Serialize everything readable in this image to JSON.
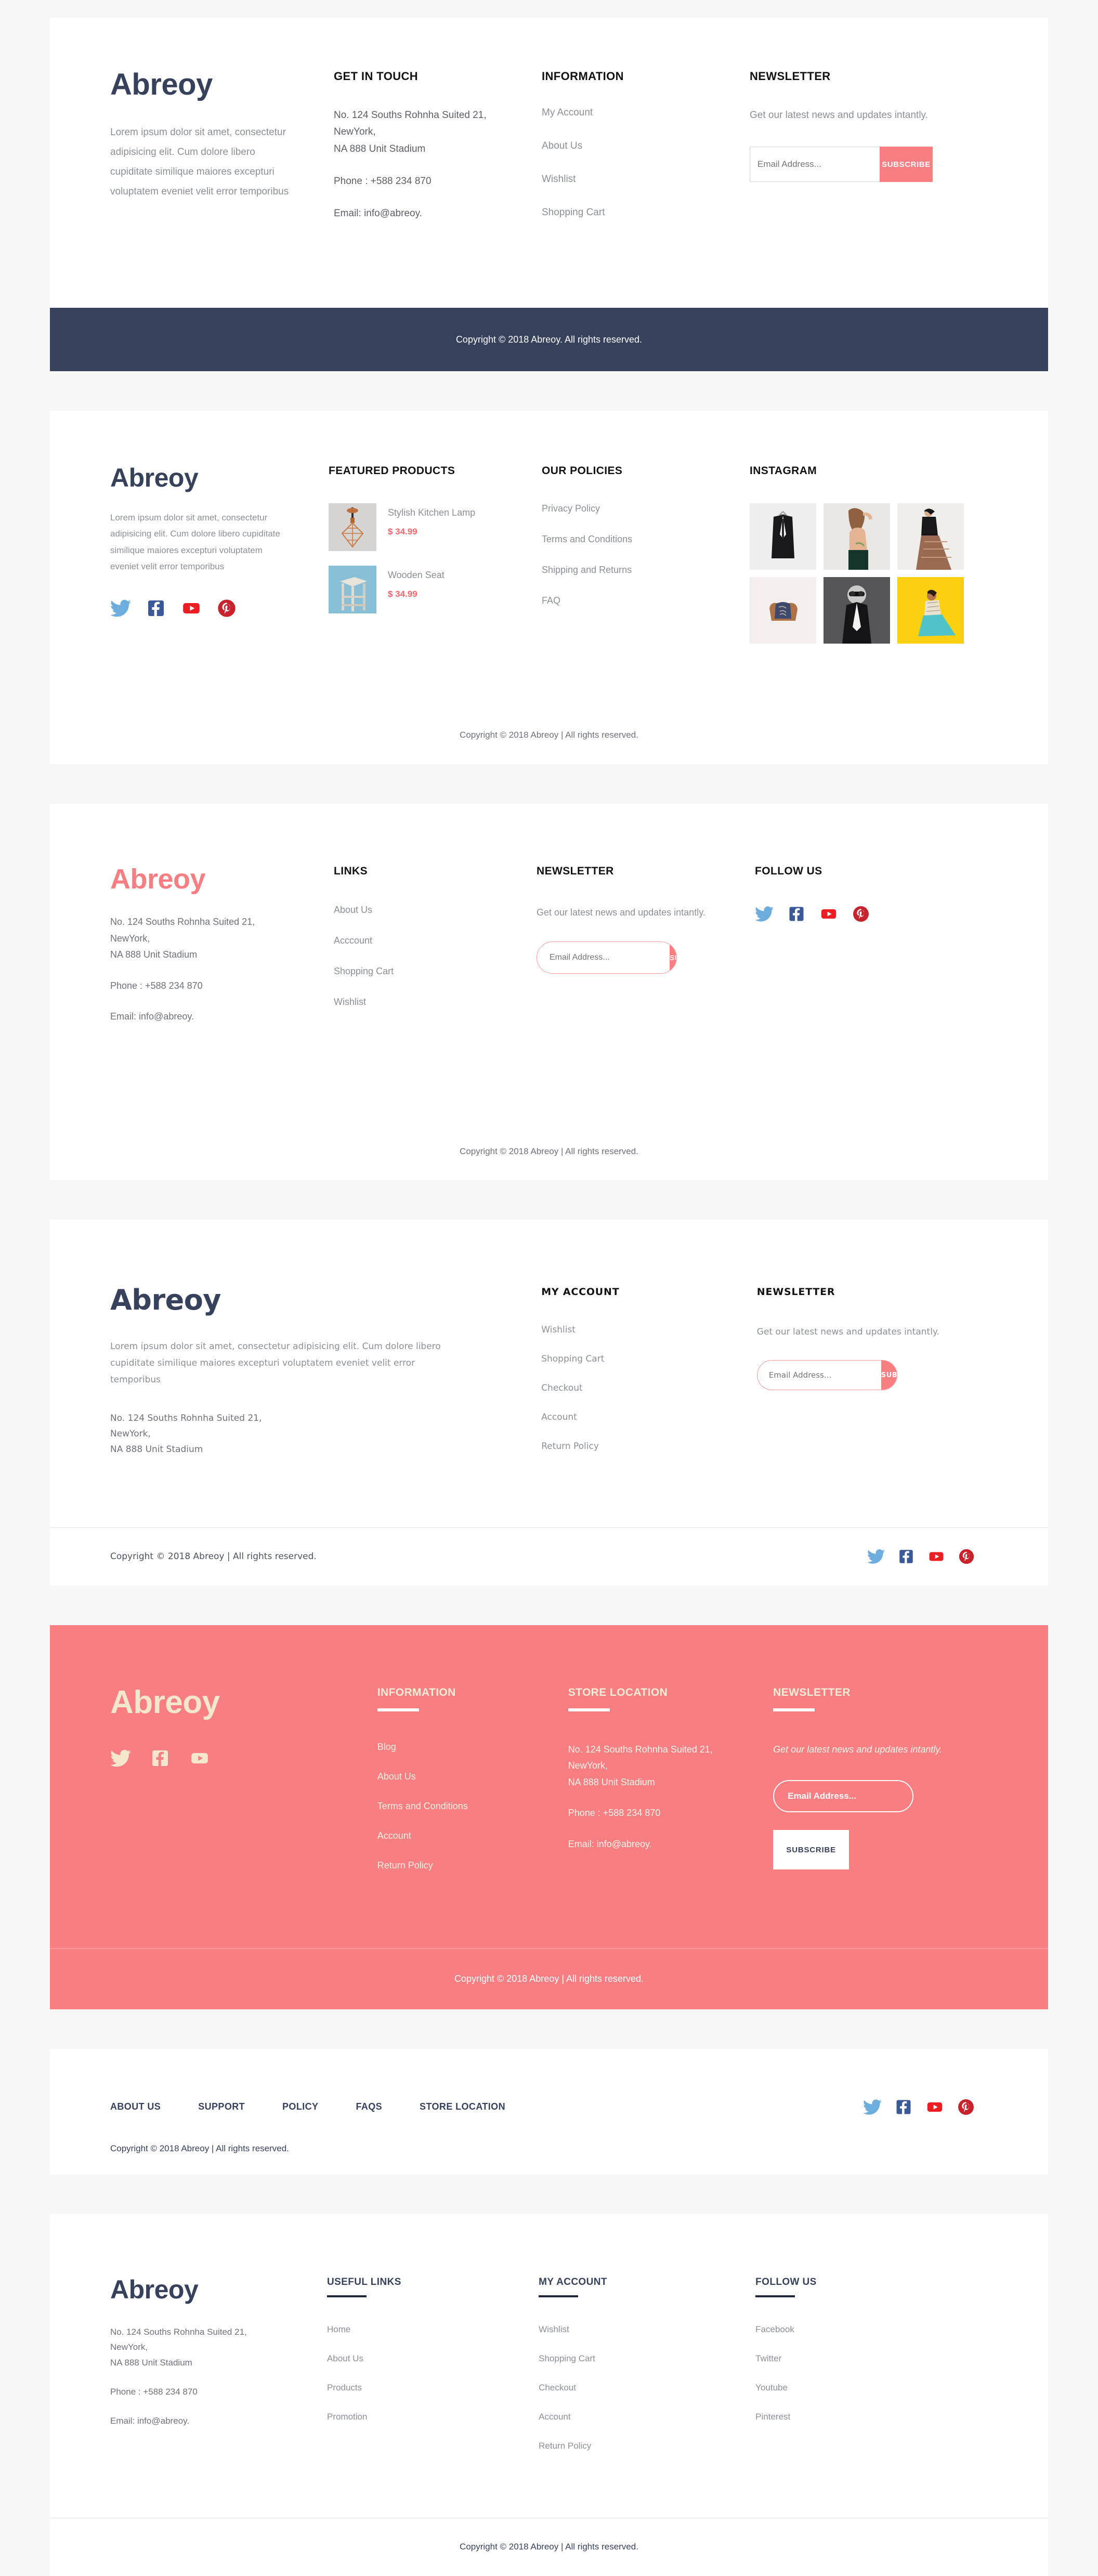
{
  "brand": "Abreoy",
  "colors": {
    "navy": "#36415c",
    "coral": "#f87e82",
    "coral_text": "#f4666c",
    "cream": "#f4e7cd",
    "page_bg": "#f7f7f7",
    "muted": "#8b8f96"
  },
  "common": {
    "address_line1": "No. 124 Souths Rohnha Suited 21,",
    "address_line2": "NewYork,",
    "address_line3": "NA 888 Unit Stadium",
    "phone": "Phone : +588 234 870",
    "email": "Email: info@abreoy.",
    "newsletter_text": "Get our latest news and updates intantly.",
    "email_placeholder": "Email Address...",
    "subscribe": "SUBSCRIBE",
    "lorem_long": "Lorem ipsum dolor sit amet, consectetur adipisicing elit. Cum dolore libero cupiditate similique maiores excepturi voluptatem eveniet velit error temporibus",
    "lorem_wide": "Lorem ipsum dolor sit amet, consectetur adipisicing elit. Cum dolore libero cupiditate similique maiores excepturi voluptatem  eveniet  velit error temporibus"
  },
  "social": [
    {
      "name": "twitter-icon",
      "label": "Twitter",
      "color": "#6dadde"
    },
    {
      "name": "facebook-icon",
      "label": "Facebook",
      "color": "#3b5998"
    },
    {
      "name": "youtube-icon",
      "label": "Youtube",
      "color": "#ed1d24"
    },
    {
      "name": "pinterest-icon",
      "label": "Pinterest",
      "color": "#c8232c"
    }
  ],
  "section1": {
    "logo": "Abreoy",
    "description": "Lorem ipsum dolor sit amet, consectetur adipisicing elit. Cum dolore libero cupiditate similique maiores excepturi voluptatem eveniet velit error temporibus",
    "get_in_touch_title": "GET IN TOUCH",
    "address_line1": "No. 124 Souths Rohnha Suited 21,",
    "address_line2": "NewYork,",
    "address_line3": "NA 888 Unit Stadium",
    "phone": "Phone : +588 234 870",
    "email": "Email: info@abreoy.",
    "information_title": "INFORMATION",
    "information_links": [
      "My Account",
      "About Us",
      "Wishlist",
      "Shopping Cart"
    ],
    "newsletter_title": "NEWSLETTER",
    "newsletter_text": "Get our latest news and updates intantly.",
    "email_placeholder": "Email Address...",
    "subscribe": "SUBSCRIBE",
    "copyright": "Copyright © 2018 Abreoy. All rights reserved."
  },
  "section2": {
    "logo": "Abreoy",
    "description": "Lorem ipsum dolor sit amet, consectetur adipisicing elit. Cum dolore libero cupiditate similique maiores excepturi voluptatem eveniet velit error temporibus",
    "featured_title": "FEATURED PRODUCTS",
    "products": [
      {
        "name": "Stylish Kitchen Lamp",
        "price": "$ 34.99",
        "image": "kitchen-lamp-thumbnail"
      },
      {
        "name": "Wooden Seat",
        "price": "$ 34.99",
        "image": "wooden-stool-thumbnail"
      }
    ],
    "policies_title": "OUR POLICIES",
    "policies_links": [
      "Privacy Policy",
      "Terms and Conditions",
      "Shipping and Returns",
      "FAQ"
    ],
    "instagram_title": "INSTAGRAM",
    "instagram": [
      "black-blazer-on-hanger",
      "model-back-with-tattoo",
      "model-in-patterned-skirt",
      "leather-wallet-flatlay",
      "bw-model-with-sunglasses",
      "model-on-yellow-backdrop"
    ],
    "copyright": "Copyright © 2018 Abreoy  | All rights reserved."
  },
  "section3": {
    "logo": "Abreoy",
    "address_line1": "No. 124 Souths Rohnha Suited 21,",
    "address_line2": "NewYork,",
    "address_line3": "NA 888 Unit Stadium",
    "phone": "Phone : +588 234 870",
    "email": "Email: info@abreoy.",
    "links_title": "LINKS",
    "links": [
      "About Us",
      "Acccount",
      "Shopping Cart",
      "Wishlist"
    ],
    "newsletter_title": "NEWSLETTER",
    "newsletter_text": "Get our latest news and updates intantly.",
    "email_placeholder": "Email Address...",
    "subscribe": "SUBSCRIBE",
    "follow_title": "FOLLOW US",
    "copyright": "Copyright © 2018 Abreoy  | All rights reserved."
  },
  "section4": {
    "logo": "Abreoy",
    "description": "Lorem ipsum dolor sit amet, consectetur adipisicing elit. Cum dolore libero cupiditate similique maiores excepturi voluptatem  eveniet  velit error temporibus",
    "address_line1": "No. 124 Souths Rohnha Suited 21,",
    "address_line2": "NewYork,",
    "address_line3": "NA 888 Unit Stadium",
    "account_title": "MY ACCOUNT",
    "account_links": [
      "Wishlist",
      "Shopping Cart",
      "Checkout",
      "Account",
      "Return Policy"
    ],
    "newsletter_title": "NEWSLETTER",
    "newsletter_text": "Get our latest news and updates intantly.",
    "email_placeholder": "Email Address...",
    "subscribe": "SUBSCRIBE",
    "copyright": "Copyright © 2018 Abreoy  | All rights reserved."
  },
  "section5": {
    "logo": "Abreoy",
    "information_title": "INFORMATION",
    "information_links": [
      "Blog",
      "About Us",
      "Terms and Conditions",
      "Account",
      "Return Policy"
    ],
    "store_title": "STORE LOCATION",
    "address_line1": "No. 124 Souths Rohnha Suited 21,",
    "address_line2": "NewYork,",
    "address_line3": "NA 888 Unit Stadium",
    "phone": "Phone : +588 234 870",
    "email": "Email: info@abreoy.",
    "newsletter_title": "NEWSLETTER",
    "newsletter_text": "Get our latest news and updates intantly.",
    "email_placeholder": "Email Address...",
    "subscribe": "SUBSCRIBE",
    "copyright": "Copyright © 2018 Abreoy  | All rights reserved."
  },
  "section6": {
    "nav": [
      "ABOUT US",
      "SUPPORT",
      "POLICY",
      "FAQS",
      "STORE LOCATION"
    ],
    "copyright": "Copyright © 2018 Abreoy  | All rights reserved."
  },
  "section7": {
    "logo": "Abreoy",
    "address_line1": "No. 124 Souths Rohnha Suited 21,",
    "address_line2": "NewYork,",
    "address_line3": "NA 888 Unit Stadium",
    "phone": "Phone : +588 234 870",
    "email": "Email: info@abreoy.",
    "useful_title": "USEFUL LINKS",
    "useful_links": [
      "Home",
      "About Us",
      "Products",
      "Promotion"
    ],
    "account_title": "MY ACCOUNT",
    "account_links": [
      "Wishlist",
      "Shopping Cart",
      "Checkout",
      "Account",
      "Return Policy"
    ],
    "follow_title": "FOLLOW US",
    "follow_links": [
      "Facebook",
      "Twitter",
      "Youtube",
      "Pinterest"
    ],
    "copyright": "Copyright © 2018 Abreoy  | All rights reserved."
  }
}
